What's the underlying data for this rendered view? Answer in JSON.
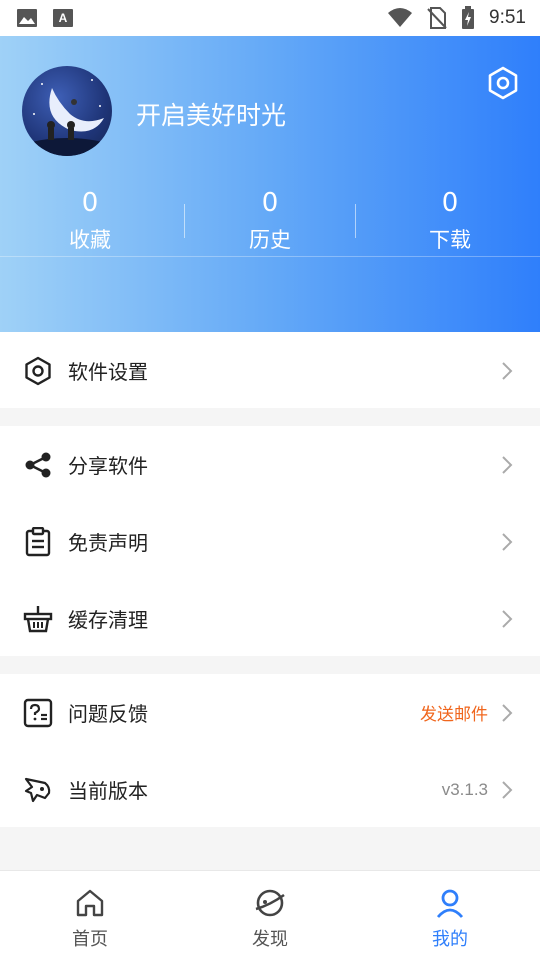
{
  "status_bar": {
    "time": "9:51"
  },
  "profile": {
    "title": "开启美好时光"
  },
  "stats": [
    {
      "value": "0",
      "label": "收藏"
    },
    {
      "value": "0",
      "label": "历史"
    },
    {
      "value": "0",
      "label": "下载"
    }
  ],
  "menu": {
    "settings": {
      "label": "软件设置"
    },
    "share": {
      "label": "分享软件"
    },
    "disclaimer": {
      "label": "免责声明"
    },
    "cache": {
      "label": "缓存清理"
    },
    "feedback": {
      "label": "问题反馈",
      "value": "发送邮件"
    },
    "version": {
      "label": "当前版本",
      "value": "v3.1.3"
    }
  },
  "nav": {
    "home": {
      "label": "首页"
    },
    "discover": {
      "label": "发现"
    },
    "mine": {
      "label": "我的"
    }
  },
  "colors": {
    "accent": "#2f7ffb",
    "gradient_start": "#9fd1f7",
    "gradient_end": "#2f7ffb",
    "feedback_value": "#f0661d",
    "version_value": "#8a8a8a"
  },
  "icons": {
    "settings_top": "hexagon-settings-icon",
    "settings_row": "hexagon-settings-icon",
    "share": "share-icon",
    "disclaimer": "clipboard-icon",
    "cache": "basket-icon",
    "feedback": "question-icon",
    "version": "rocket-icon",
    "home": "home-icon",
    "discover": "planet-icon",
    "mine": "user-icon"
  }
}
